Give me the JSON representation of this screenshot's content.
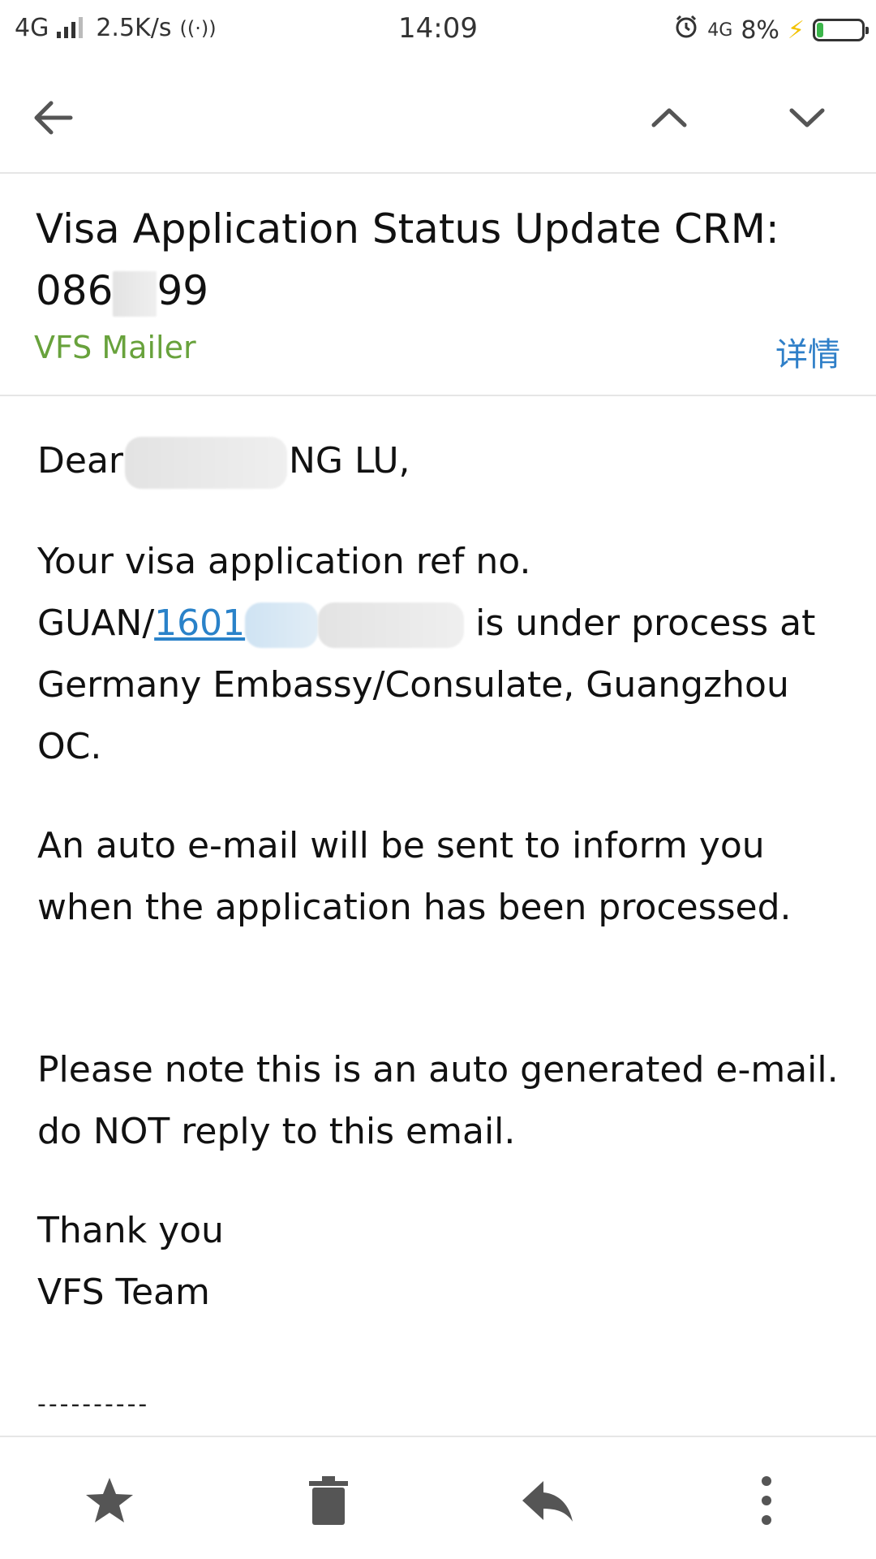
{
  "status_bar": {
    "network": "4G",
    "speed": "2.5K/s",
    "time": "14:09",
    "net_right": "4G",
    "battery": "8%",
    "battery_level": 0.08
  },
  "toolbar": {
    "back_icon": "arrow-left-icon",
    "prev_icon": "chevron-up-icon",
    "next_icon": "chevron-down-icon"
  },
  "email": {
    "subject_line1": "Visa Application Status Update CRM:",
    "subject_line2_a": "086",
    "subject_line2_b": "99",
    "sender": "VFS Mailer",
    "details_label": "详情",
    "greeting_a": "Dear",
    "greeting_b": "NG LU,",
    "ref_line1": "Your visa application ref no.",
    "ref_prefix": "GUAN/",
    "ref_link": "1601",
    "ref_rest": " is under process at",
    "ref_line3": "Germany Embassy/Consulate, Guangzhou",
    "ref_line4": "OC.",
    "auto_line1": "An auto e-mail will be sent to inform you",
    "auto_line2": "when the application has been processed.",
    "note_line1": "Please note this is an auto generated e-mail.",
    "note_line2": "do NOT reply to this email.",
    "thanks": "Thank you",
    "team": "VFS Team",
    "separator": "----------"
  },
  "bottom_bar": {
    "star_icon": "star-icon",
    "delete_icon": "trash-icon",
    "reply_icon": "reply-icon",
    "more_icon": "more-vertical-icon"
  }
}
